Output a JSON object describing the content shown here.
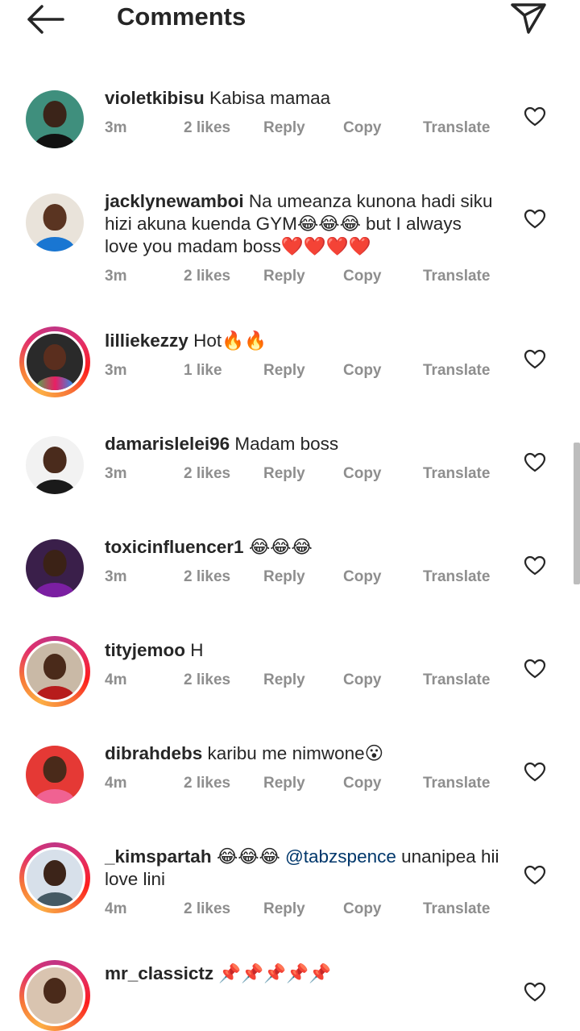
{
  "header": {
    "title": "Comments"
  },
  "comments": [
    {
      "user": "violetkibisu",
      "text": " Kabisa mamaa",
      "time": "3m",
      "likes": "2 likes"
    },
    {
      "user": "jacklynewamboi",
      "text": " Na umeanza kunona hadi siku hizi akuna kuenda GYM😂😂😂 but I always love you madam boss❤️❤️❤️❤️",
      "time": "3m",
      "likes": "2 likes"
    },
    {
      "user": "lilliekezzy",
      "text": " Hot🔥🔥",
      "time": "3m",
      "likes": "1 like"
    },
    {
      "user": "damarislelei96",
      "text": " Madam boss",
      "time": "3m",
      "likes": "2 likes"
    },
    {
      "user": "toxicinfluencer1",
      "text": " 😂😂😂",
      "time": "3m",
      "likes": "2 likes"
    },
    {
      "user": "tityjemoo",
      "text": " H",
      "time": "4m",
      "likes": "2 likes"
    },
    {
      "user": "dibrahdebs",
      "text": " karibu me nimwone😮",
      "time": "4m",
      "likes": "2 likes"
    },
    {
      "user": "_kimspartah",
      "text_before": " 😂😂😂 ",
      "mention": "@tabzspence",
      "text_after": " unanipea hii love lini",
      "time": "4m",
      "likes": "2 likes"
    },
    {
      "user": "mr_classictz",
      "text": " 📌📌📌📌📌"
    }
  ],
  "actions": {
    "reply": "Reply",
    "copy": "Copy",
    "translate": "Translate"
  },
  "colors": {
    "text": "#262626",
    "meta": "#8e8e8e",
    "mention": "#00376b",
    "story_ring_start": "#c13584",
    "story_ring_end": "#fcaf45"
  },
  "icons": {
    "back": "arrow-left-icon",
    "send": "paper-plane-icon",
    "like": "heart-outline-icon"
  }
}
